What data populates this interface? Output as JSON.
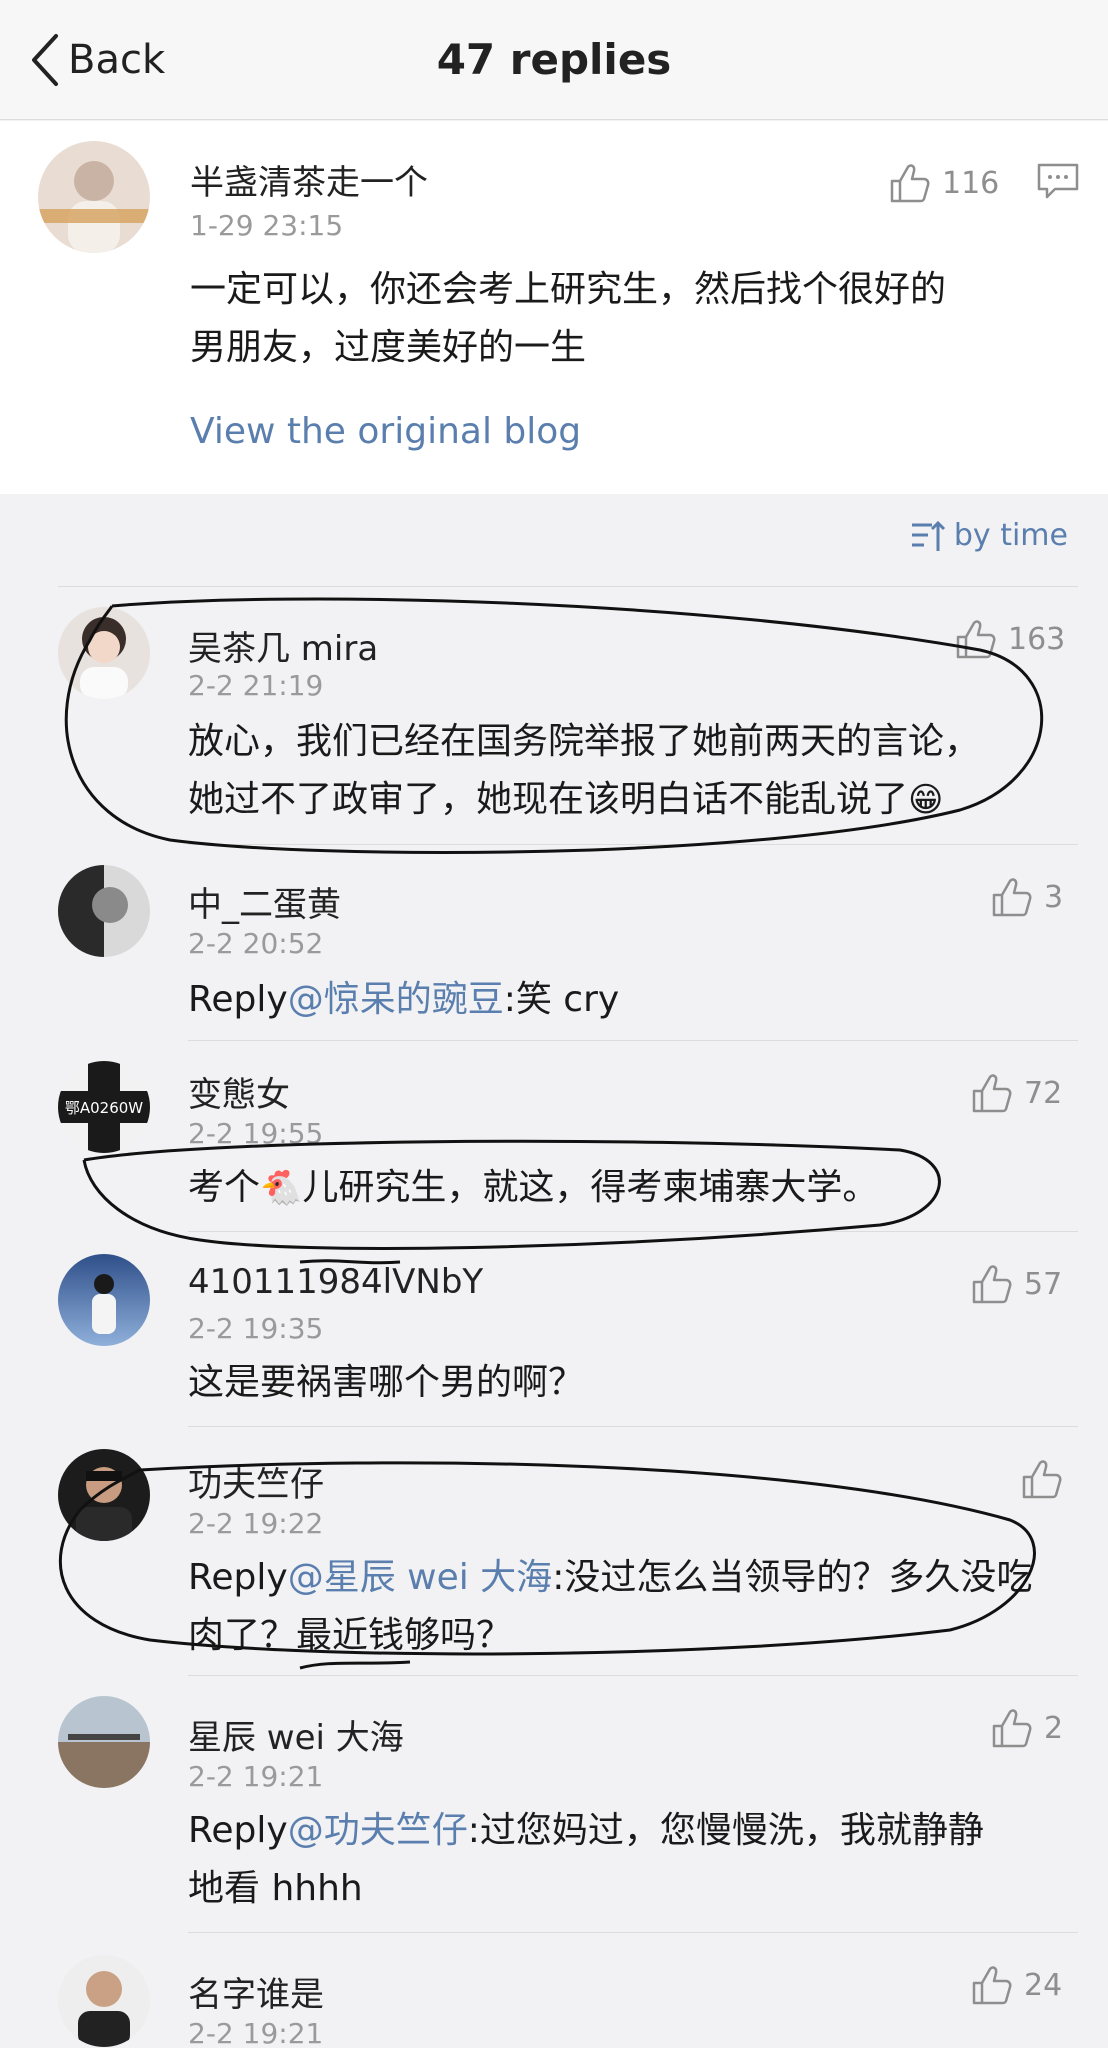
{
  "nav": {
    "back_label": "Back",
    "title": "47 replies"
  },
  "main_comment": {
    "author": "半盏清茶走一个",
    "time": "1-29 23:15",
    "likes": "116",
    "text_line1": "一定可以，你还会考上研究生，然后找个很好的",
    "text_line2": "男朋友，过度美好的一生",
    "view_original": "View the original blog"
  },
  "sort_label": "by time",
  "replies": [
    {
      "author": "吴茶几 mira",
      "time": "2-2 21:19",
      "likes": "163",
      "line1": "放心，我们已经在国务院举报了她前两天的言论，",
      "line2": "她过不了政审了，她现在该明白话不能乱说了",
      "emoji": "😁"
    },
    {
      "author": "中_二蛋黄",
      "time": "2-2 20:52",
      "likes": "3",
      "reply_prefix": "Reply",
      "mention": "@惊呆的豌豆",
      "text": ":笑 cry"
    },
    {
      "author": "变態女",
      "time": "2-2 19:55",
      "likes": "72",
      "avatar_text": "鄂A0260W",
      "text_before": "考个",
      "emoji": "🐔",
      "text_after": "儿研究生，就这，得考柬埔寨大学。"
    },
    {
      "author": "410111984lVNbY",
      "time": "2-2 19:35",
      "likes": "57",
      "text": "这是要祸害哪个男的啊？"
    },
    {
      "author": "功夫竺仔",
      "time": "2-2 19:22",
      "likes": "",
      "reply_prefix": "Reply",
      "mention": "@星辰 wei 大海",
      "text_line1": ":没过怎么当领导的？多久没吃",
      "text_line2": "肉了？最近钱够吗？"
    },
    {
      "author": "星辰 wei 大海",
      "time": "2-2 19:21",
      "likes": "2",
      "reply_prefix": "Reply",
      "mention": "@功夫竺仔",
      "text_line1": ":过您妈过，您慢慢洗，我就静静",
      "text_line2": "地看 hhhh"
    },
    {
      "author": "名字谁是",
      "time": "2-2 19:21",
      "likes": "24"
    }
  ],
  "colors": {
    "link": "#5a7fae",
    "background": "#f2f2f4",
    "card": "#ffffff",
    "muted": "#9a9a9a"
  }
}
